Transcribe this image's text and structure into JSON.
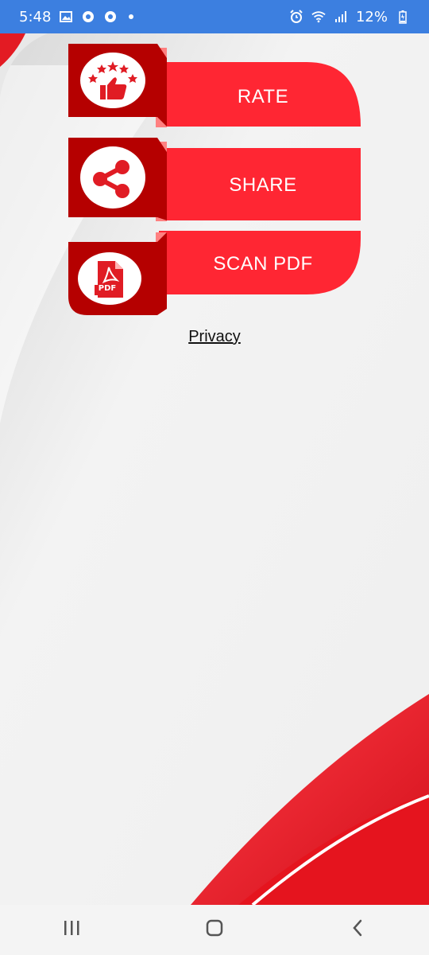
{
  "status_bar": {
    "time": "5:48",
    "battery": "12%",
    "icons": [
      "gallery-icon",
      "chrome-icon",
      "chrome-icon",
      "notification-dot",
      "alarm-icon",
      "wifi-icon",
      "signal-icon",
      "battery-charging-icon"
    ]
  },
  "colors": {
    "primary_red": "#ff2633",
    "dark_red": "#b50000",
    "status_bar": "#3c7fe0"
  },
  "menu": {
    "rate": {
      "label": "RATE",
      "icon": "rate-stars-thumbs-up-icon"
    },
    "share": {
      "label": "SHARE",
      "icon": "share-icon"
    },
    "scan_pdf": {
      "label": "SCAN PDF",
      "icon": "pdf-file-icon",
      "icon_text": "PDF"
    }
  },
  "privacy": {
    "label": "Privacy"
  },
  "nav_bar": {
    "icons": [
      "recent-apps-icon",
      "home-icon",
      "back-icon"
    ]
  }
}
